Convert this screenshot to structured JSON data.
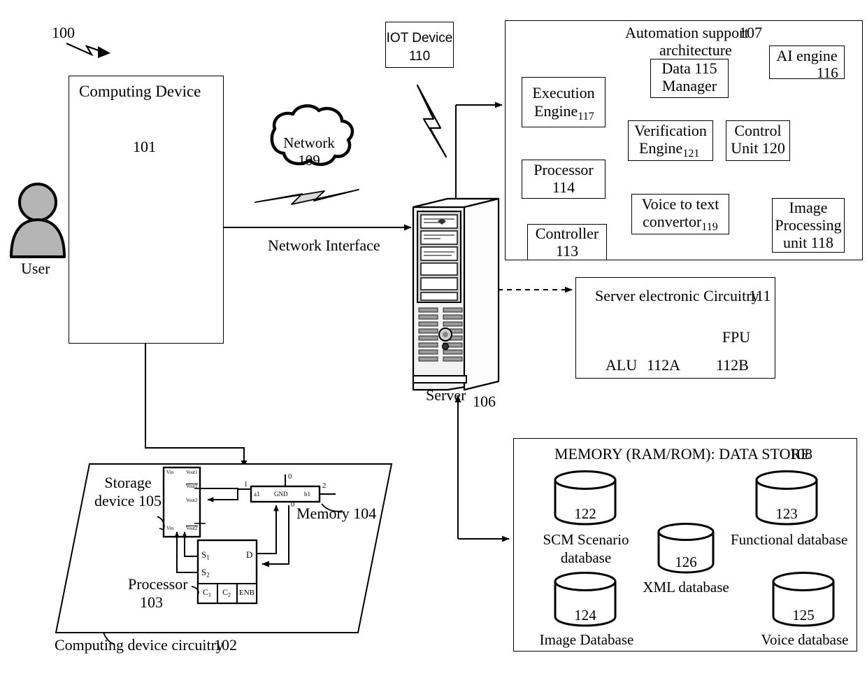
{
  "figure": {
    "ref": "100"
  },
  "computing_device": {
    "title": "Computing Device",
    "ref": "101",
    "devices": [
      "desktop-computer-icon",
      "mobile-phone-icon",
      "laptop-icon",
      "tablet-stylus-icon"
    ]
  },
  "user": {
    "label": "User",
    "icon": "user-avatar-icon"
  },
  "network": {
    "label": "Network",
    "ref": "109",
    "icon": "cloud-icon"
  },
  "iot_device": {
    "label": "IOT Device",
    "ref": "110"
  },
  "network_interface": {
    "label": "Network Interface"
  },
  "server": {
    "label": "Server",
    "ref": "106",
    "icon": "server-tower-icon"
  },
  "architecture": {
    "title_line1": "Automation support",
    "title_ref": "107",
    "title_line2": "architecture",
    "blocks": [
      {
        "id": "execution-engine",
        "line1": "Execution",
        "line2": "Engine",
        "ref": "117"
      },
      {
        "id": "data-manager",
        "line1": "Data",
        "ref": "115",
        "line2": "Manager"
      },
      {
        "id": "ai-engine",
        "line1": "AI engine",
        "ref": "116"
      },
      {
        "id": "verification-engine",
        "line1": "Verification",
        "line2": "Engine",
        "ref": "121"
      },
      {
        "id": "control-unit",
        "line1": "Control",
        "line2": "Unit",
        "ref": "120"
      },
      {
        "id": "processor",
        "line1": "Processor",
        "ref": "114"
      },
      {
        "id": "voice-to-text",
        "line1": "Voice to text",
        "line2": "convertor",
        "ref": "119"
      },
      {
        "id": "image-processing",
        "line1": "Image",
        "line2": "Processing",
        "line3": "unit",
        "ref": "118"
      },
      {
        "id": "controller",
        "line1": "Controller",
        "ref": "113"
      }
    ]
  },
  "server_circuitry": {
    "title": "Server electronic Circuitry",
    "ref": "111",
    "alu": {
      "label": "ALU",
      "ref": "112A",
      "icon": "alu-symbol-icon"
    },
    "fpu": {
      "label": "FPU",
      "ref": "112B",
      "icon": "fpu-chip-icon"
    }
  },
  "memory_store": {
    "title": "MEMORY (RAM/ROM): DATA STORE",
    "ref": "108",
    "databases": [
      {
        "id": "scm-scenario",
        "ref": "122",
        "line1": "SCM Scenario",
        "line2": "database"
      },
      {
        "id": "functional",
        "ref": "123",
        "line1": "Functional database"
      },
      {
        "id": "xml",
        "ref": "126",
        "line1": "XML database"
      },
      {
        "id": "image",
        "ref": "124",
        "line1": "Image Database"
      },
      {
        "id": "voice",
        "ref": "125",
        "line1": "Voice database"
      }
    ]
  },
  "computing_device_circuitry": {
    "caption": "Computing device circuitry",
    "ref": "102",
    "storage_device": {
      "line1": "Storage",
      "line2": "device",
      "ref": "105"
    },
    "memory": {
      "label": "Memory",
      "ref": "104"
    },
    "processor": {
      "label": "Processor",
      "ref": "103"
    },
    "pins": {
      "vin_top": "Vin",
      "vin_bottom": "Vin",
      "vout1": "Vout1",
      "vout1_bar": "Vout1",
      "vout2": "Vout2",
      "vout2_bar": "Vout2",
      "mux_left": "a1",
      "mux_center": "GND",
      "mux_right": "b1",
      "n1": "1",
      "n2": "2",
      "n0_top": "0",
      "n0_bottom": "0",
      "s1": "S",
      "s1_sub": "1",
      "s2": "S",
      "s2_sub": "2",
      "d": "D",
      "c1": "C",
      "c1_sub": "1",
      "c2": "C",
      "c2_sub": "2",
      "enb": "ENB"
    }
  }
}
